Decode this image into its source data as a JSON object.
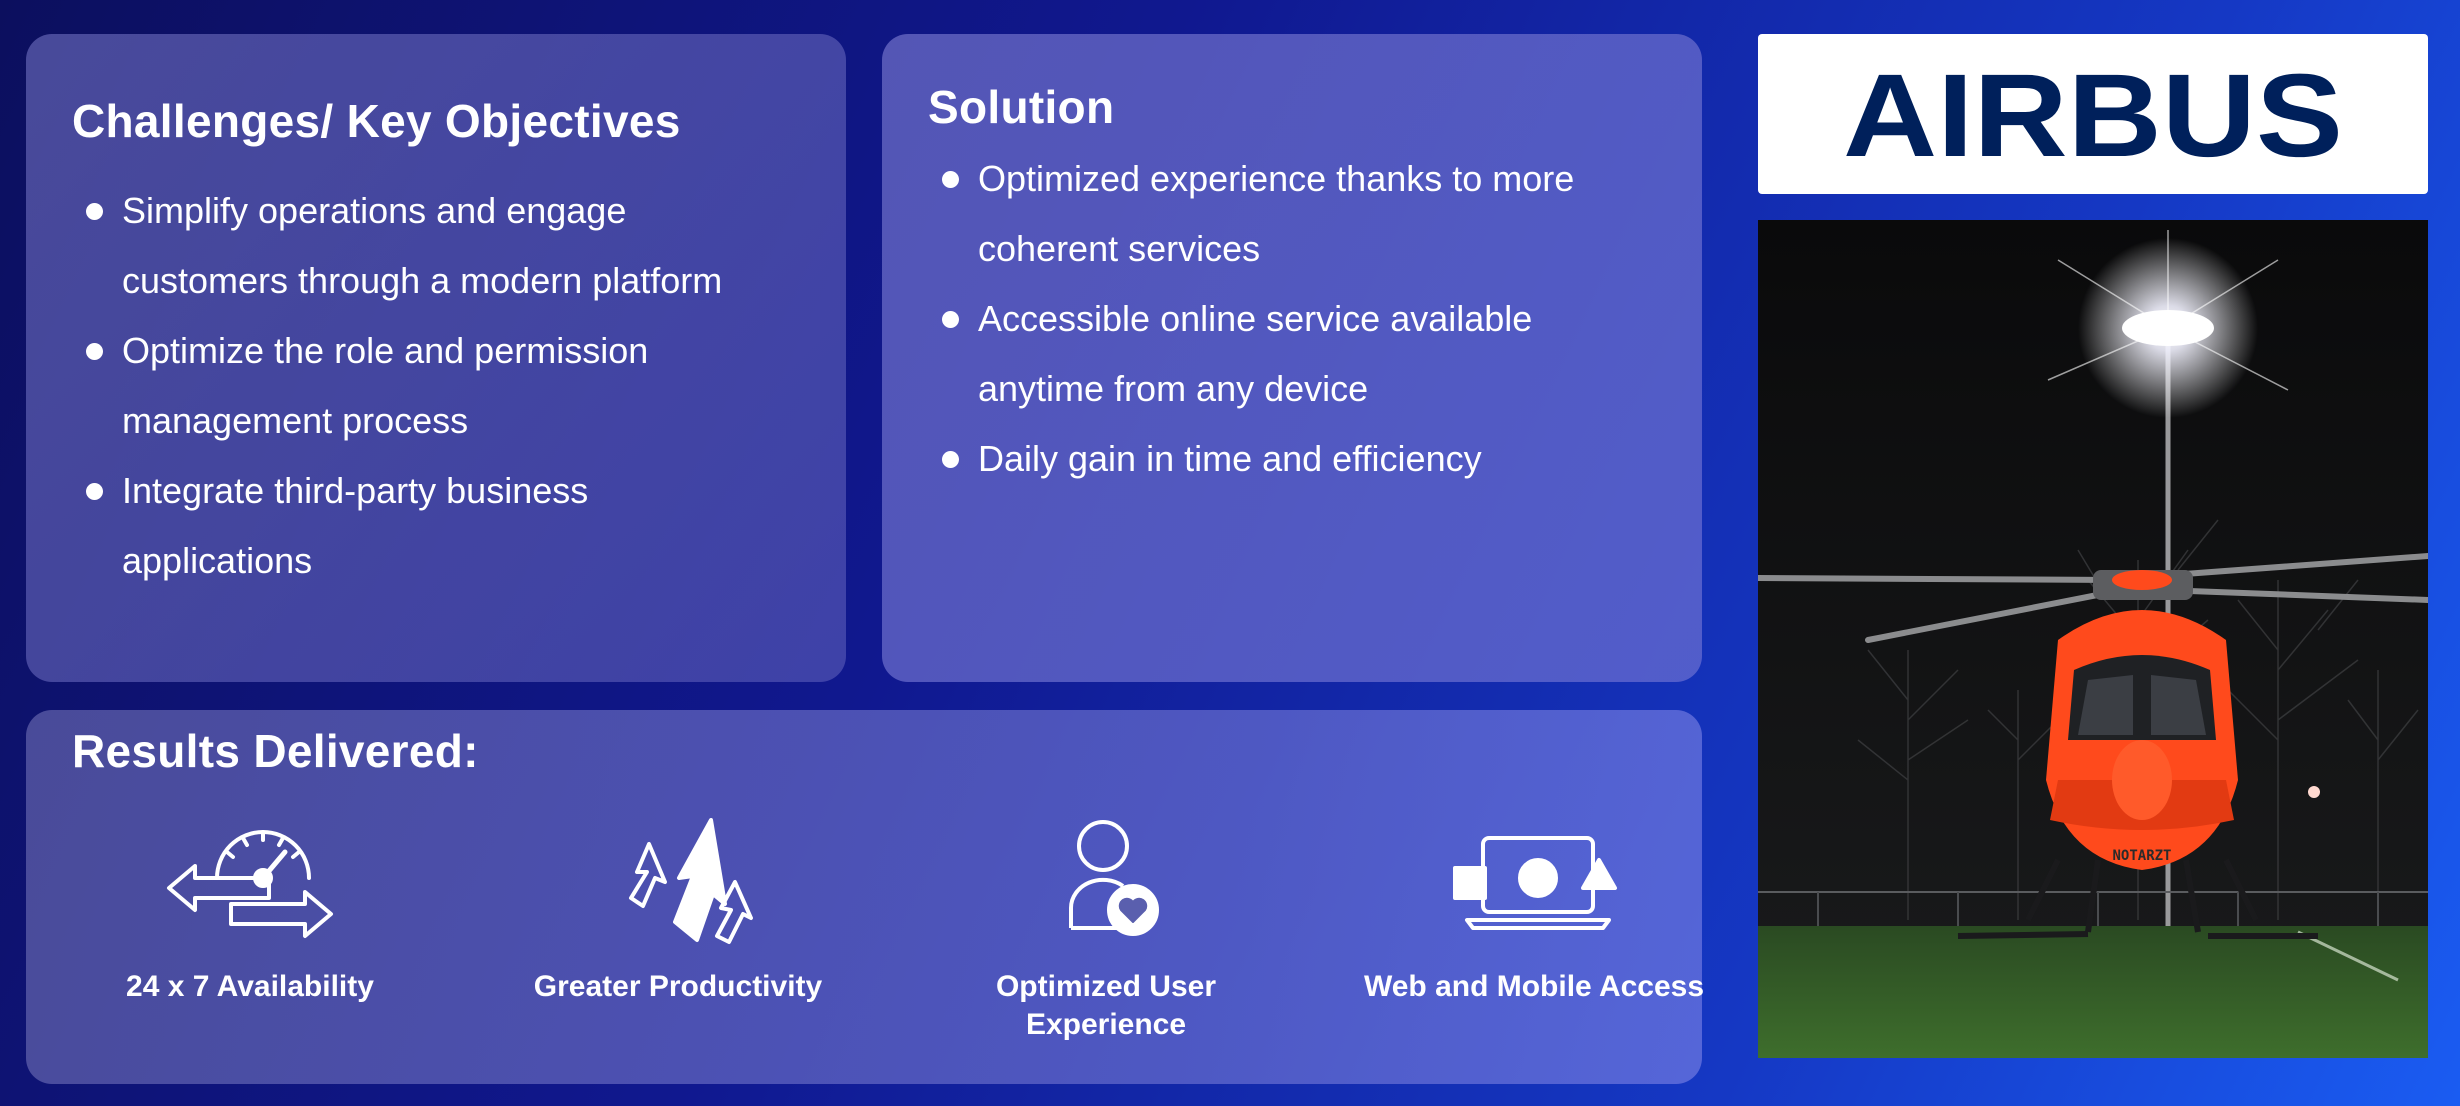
{
  "challenges": {
    "title": "Challenges/ Key Objectives",
    "items": [
      "Simplify operations and engage customers through a modern platform",
      "Optimize the role and permission management process",
      "Integrate third-party business applications"
    ]
  },
  "solution": {
    "title": "Solution",
    "items": [
      "Optimized experience thanks to more coherent services",
      "Accessible online service available anytime from any device",
      "Daily gain in time and efficiency"
    ]
  },
  "results": {
    "title": "Results Delivered:",
    "items": [
      {
        "label": "24 x 7 Availability",
        "icon": "speedometer-arrows-icon"
      },
      {
        "label": "Greater Productivity",
        "icon": "rising-arrows-icon"
      },
      {
        "label": "Optimized User Experience",
        "icon": "user-heart-icon"
      },
      {
        "label": "Web and Mobile Access",
        "icon": "devices-shapes-icon"
      }
    ]
  },
  "logo": {
    "text": "AIRBUS",
    "color": "#00205b"
  },
  "photo": {
    "description_icon": "helicopter-photo",
    "fuselage_text": "NOTARZT"
  },
  "colors": {
    "background_start": "#0c0f5e",
    "background_end": "#1a5cf2",
    "text": "#ffffff",
    "helicopter": "#ff4a1c"
  }
}
